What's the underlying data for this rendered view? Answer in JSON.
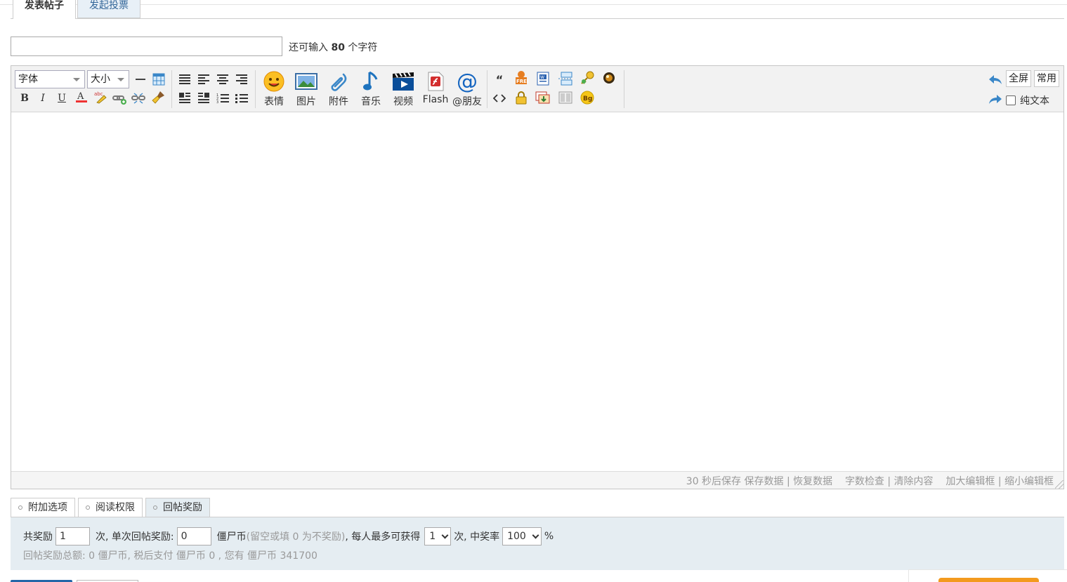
{
  "tabs": [
    "发表帖子",
    "发起投票"
  ],
  "subject": {
    "value": "",
    "hint_prefix": "还可输入",
    "hint_count": "80",
    "hint_suffix": "个字符"
  },
  "toolbar": {
    "font_select": "字体",
    "size_select": "大小",
    "big_tools": [
      "表情",
      "图片",
      "附件",
      "音乐",
      "视频",
      "Flash",
      "@朋友"
    ],
    "fullscreen": "全屏",
    "common": "常用",
    "plain_text": "纯文本"
  },
  "status": {
    "autosave": "30 秒后保存",
    "save": "保存数据",
    "restore": "恢复数据",
    "wordcount": "字数检查",
    "clear": "清除内容",
    "enlarge": "加大编辑框",
    "shrink": "缩小编辑框",
    "sep": "|"
  },
  "bottom_tabs": [
    "附加选项",
    "阅读权限",
    "回帖奖励"
  ],
  "reward": {
    "total_label": "共奖励",
    "total_value": "1",
    "times_label": "次, 单次回帖奖励:",
    "single_value": "0",
    "currency": "僵尸币",
    "note": "(留空或填 0 为不奖励)",
    "per_person": ", 每人最多可获得",
    "per_person_value": "1",
    "rate_label": "次, 中奖率",
    "rate_value": "100",
    "percent": "%",
    "summary": "回帖奖励总额: 0 僵尸币, 税后支付 僵尸币 0 , 您有 僵尸币 341700"
  }
}
